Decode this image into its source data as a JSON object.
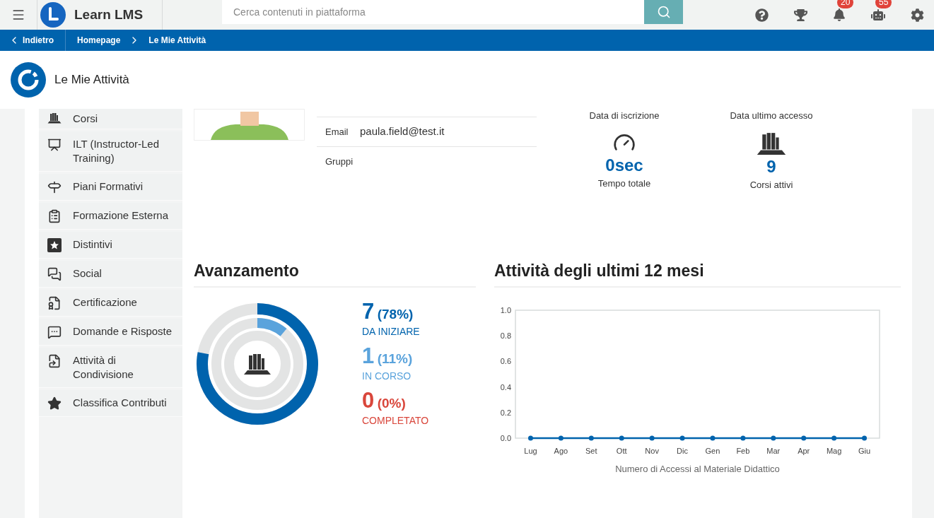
{
  "topbar": {
    "brand": "Learn LMS",
    "search": {
      "placeholder": "Cerca contenuti in piattaforma"
    },
    "badges": [
      {
        "kind": "bell",
        "count": "20"
      },
      {
        "kind": "robot",
        "count": "55"
      }
    ]
  },
  "breadcrumb": {
    "back": "Indietro",
    "items": [
      "Homepage",
      "Le Mie Attività"
    ]
  },
  "page_title": "Le Mie Attività",
  "sidebar": {
    "items": [
      {
        "label": "Corsi"
      },
      {
        "label": "ILT (Instructor-Led Training)"
      },
      {
        "label": "Piani Formativi"
      },
      {
        "label": "Formazione Esterna"
      },
      {
        "label": "Distintivi"
      },
      {
        "label": "Social"
      },
      {
        "label": "Certificazione"
      },
      {
        "label": "Domande e Risposte"
      },
      {
        "label": "Attività di Condivisione"
      },
      {
        "label": "Classifica Contributi"
      }
    ]
  },
  "profile": {
    "fields": [
      {
        "label": "Email",
        "value": "paula.field@test.it"
      },
      {
        "label": "Gruppi"
      }
    ]
  },
  "stats": {
    "headers": [
      "Data di iscrizione",
      "Data ultimo accesso"
    ],
    "items": [
      {
        "kind": "time",
        "value": "0sec",
        "label": "Tempo totale"
      },
      {
        "kind": "courses",
        "value": "9",
        "label": "Corsi attivi"
      }
    ]
  },
  "progress": {
    "title": "Avanzamento",
    "items": [
      {
        "count": "7",
        "percent": "(78%)",
        "label": "DA INIZIARE",
        "color": "#0063ad",
        "level": 0.78
      },
      {
        "count": "1",
        "percent": "(11%)",
        "label": "IN CORSO",
        "color": "#5aa3dc",
        "level": 0.11
      },
      {
        "count": "0",
        "percent": "(0%)",
        "label": "COMPLETATO",
        "color": "#d9463b"
      }
    ]
  },
  "activity": {
    "title": "Attività degli ultimi 12 mesi",
    "chart_data": {
      "type": "line",
      "xlabel": "Numero di Accessi al Materiale Didattico",
      "categories": [
        "Lug",
        "Ago",
        "Set",
        "Ott",
        "Nov",
        "Dic",
        "Gen",
        "Feb",
        "Mar",
        "Apr",
        "Mag",
        "Giu"
      ],
      "ylim": [
        0,
        1
      ],
      "yticks": [
        {
          "value": 0,
          "label": "0.0"
        },
        {
          "value": 0.2,
          "label": "0.2"
        },
        {
          "value": 0.4,
          "label": "0.4"
        },
        {
          "value": 0.6,
          "label": "0.6"
        },
        {
          "value": 0.8,
          "label": "0.8"
        },
        {
          "value": 1,
          "label": "1.0"
        }
      ],
      "series": [
        {
          "color": "#0063ad",
          "marker": true,
          "values": [
            0,
            0,
            0,
            0,
            0,
            0,
            0,
            0,
            0,
            0,
            0,
            0
          ]
        }
      ]
    }
  }
}
